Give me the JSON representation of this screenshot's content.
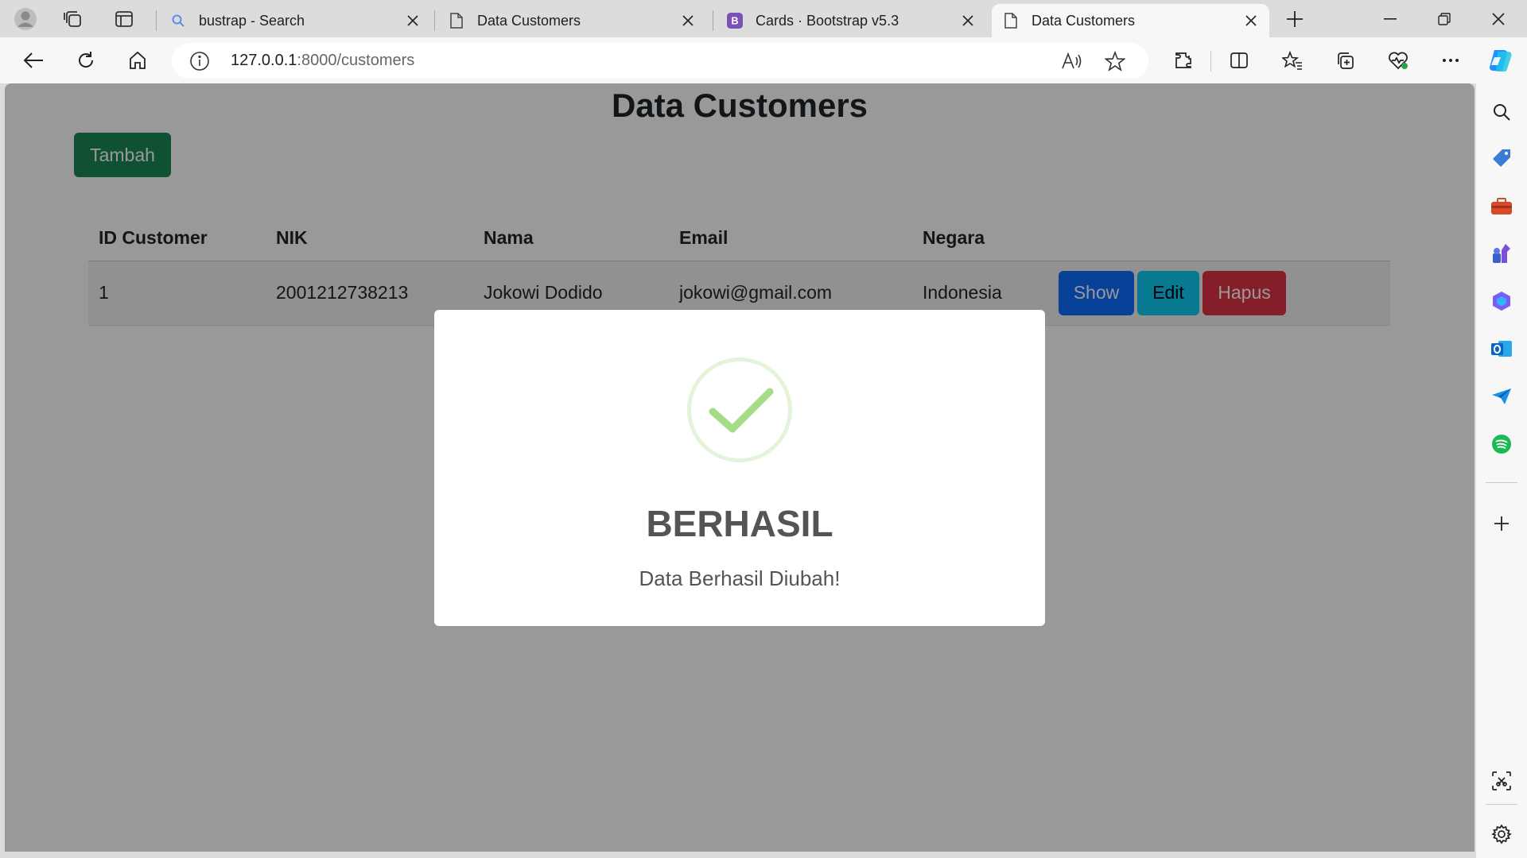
{
  "browser": {
    "tabs": [
      {
        "title": "bustrap - Search",
        "favicon": "search-icon"
      },
      {
        "title": "Data Customers",
        "favicon": "page-icon"
      },
      {
        "title": "Cards · Bootstrap v5.3",
        "favicon": "bootstrap-icon"
      },
      {
        "title": "Data Customers",
        "favicon": "page-icon",
        "active": true
      }
    ],
    "url_host": "127.0.0.1",
    "url_path": ":8000/customers",
    "accent": "#0078d4"
  },
  "page": {
    "title": "Data Customers",
    "add_button": "Tambah",
    "table": {
      "headers": [
        "ID Customer",
        "NIK",
        "Nama",
        "Email",
        "Negara"
      ],
      "rows": [
        {
          "id": "1",
          "nik": "2001212738213",
          "nama": "Jokowi Dodido",
          "email": "jokowi@gmail.com",
          "negara": "Indonesia",
          "actions": {
            "show": "Show",
            "edit": "Edit",
            "hapus": "Hapus"
          }
        }
      ]
    }
  },
  "modal": {
    "icon": "success-check-icon",
    "title": "BERHASIL",
    "text": "Data Berhasil Diubah!",
    "check_color": "#a5dc86"
  }
}
